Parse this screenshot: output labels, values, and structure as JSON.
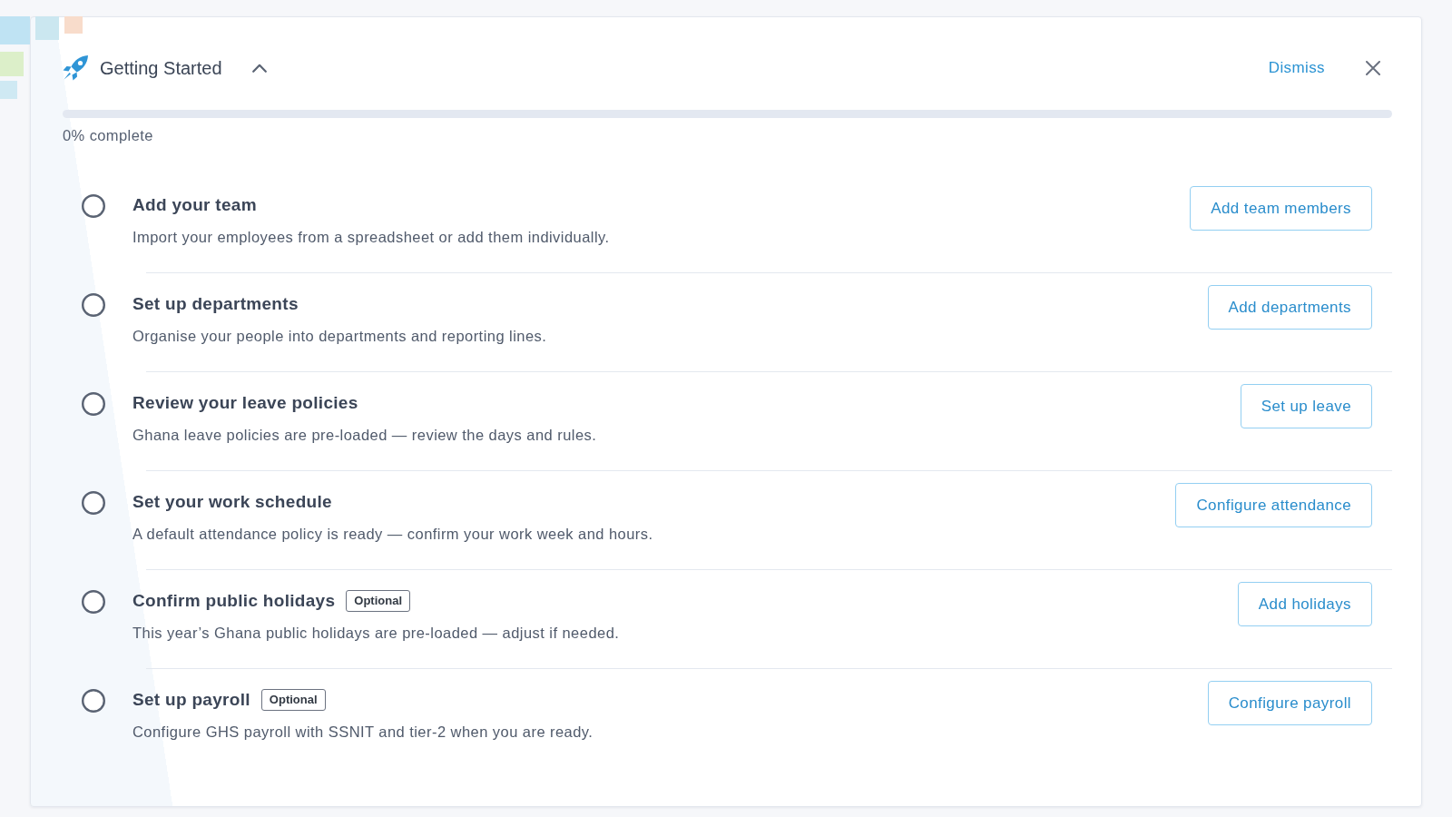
{
  "header": {
    "title": "Getting Started",
    "expanded": true,
    "dismiss": "Dismiss"
  },
  "progress": {
    "level": 0,
    "label": "0% complete"
  },
  "tasks": [
    {
      "title": "Add your team",
      "description": "Import your employees from a spreadsheet or add them individually.",
      "done": false,
      "action": "Add team members"
    },
    {
      "title": "Set up departments",
      "description": "Organise your people into departments and reporting lines.",
      "done": false,
      "action": "Add departments"
    },
    {
      "title": "Review your leave policies",
      "description": "Ghana leave policies are pre-loaded — review the days and rules.",
      "done": false,
      "action": "Set up leave"
    },
    {
      "title": "Set your work schedule",
      "description": "A default attendance policy is ready — confirm your work week and hours.",
      "done": false,
      "action": "Configure attendance"
    },
    {
      "title": "Confirm public holidays",
      "badge": "Optional",
      "description": "This year’s Ghana public holidays are pre-loaded — adjust if needed.",
      "done": false,
      "action": "Add holidays"
    },
    {
      "title": "Set up payroll",
      "badge": "Optional",
      "description": "Configure GHS payroll with SSNIT and tier-2 when you are ready.",
      "done": false,
      "action": "Configure payroll"
    }
  ]
}
